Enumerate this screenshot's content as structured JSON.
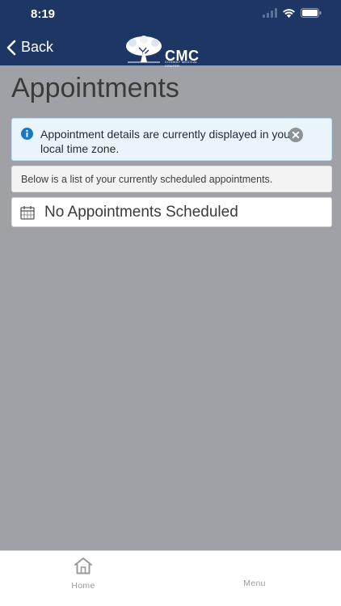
{
  "status_bar": {
    "time": "8:19"
  },
  "header": {
    "back_label": "Back",
    "logo_text": "CMC",
    "logo_subtext": "CONWAY MEDICAL CENTER"
  },
  "page": {
    "title": "Appointments"
  },
  "alert": {
    "message": "Appointment details are currently displayed in your local time zone."
  },
  "list": {
    "description": "Below is a list of your currently scheduled appointments.",
    "empty_message": "No Appointments Scheduled"
  },
  "tabbar": {
    "home_label": "Home",
    "menu_label": "Menu"
  },
  "colors": {
    "header_bg": "#1e3663",
    "alert_bg": "#e9f4fb",
    "info_icon": "#1877c4",
    "page_bg": "#a0a1a6"
  }
}
